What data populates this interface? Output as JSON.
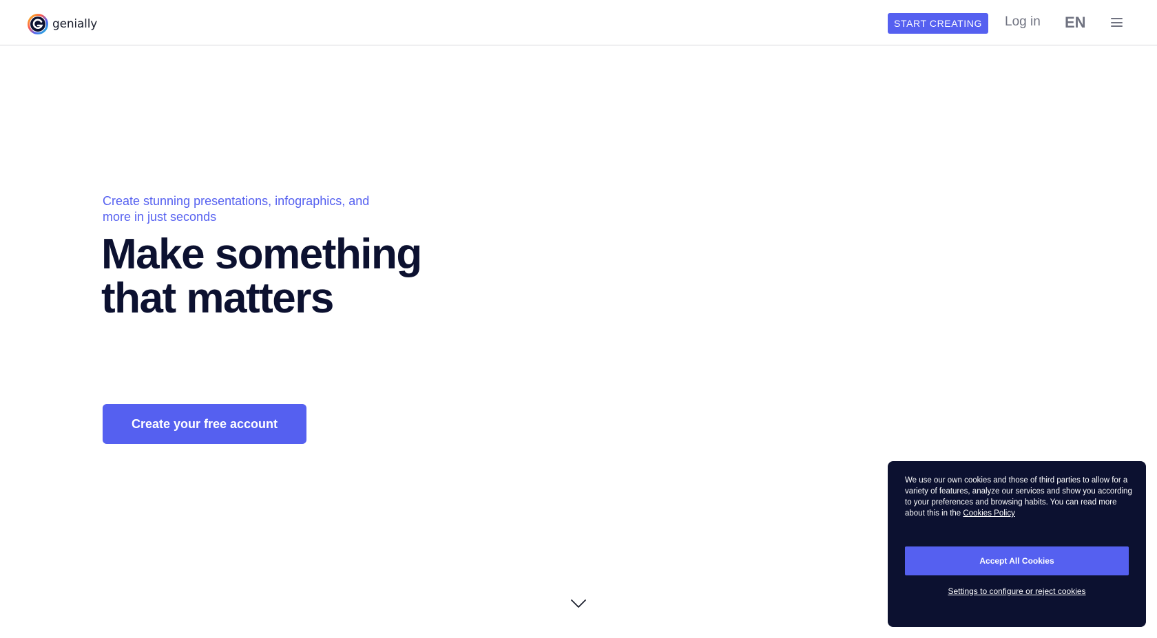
{
  "header": {
    "logo_text": "genially",
    "start_label": "START CREATING",
    "login_label": "Log in",
    "language": "EN",
    "menu_icon": "hamburger-menu-icon"
  },
  "hero": {
    "subtitle": "Create stunning presentations, infographics, and more in just seconds",
    "title_line1": "Make something",
    "title_line2": "that matters",
    "cta_label": "Create your free account",
    "scroll_icon": "chevron-down-icon"
  },
  "cookies": {
    "text": "We use our own cookies and those of third parties to allow for a variety of features, analyze our services and show you according to your preferences and browsing habits. You can read more about this in the",
    "policy_link": "Cookies Policy",
    "accept_label": "Accept All Cookies",
    "settings_label": "Settings to configure or reject cookies"
  },
  "colors": {
    "accent": "#5560f0",
    "dark": "#0c1130",
    "muted": "#6f7280",
    "background": "#ffffff"
  }
}
